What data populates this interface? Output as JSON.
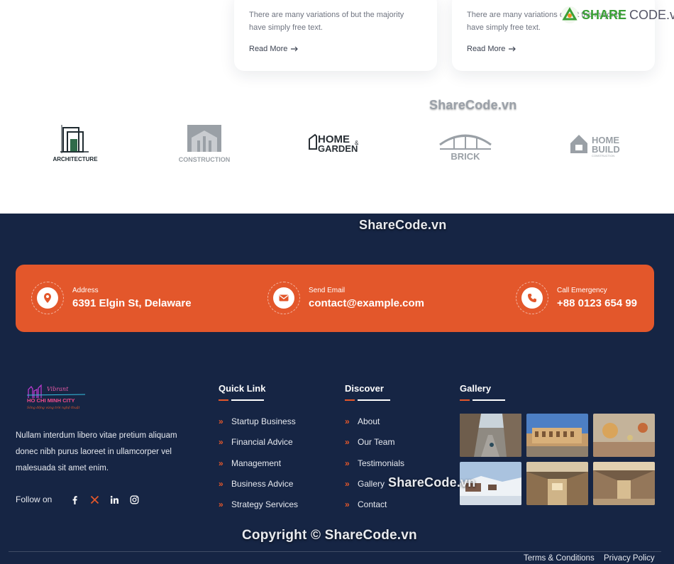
{
  "cards": [
    {
      "text": "There are many variations of but the majority have simply free text.",
      "link": "Read More"
    },
    {
      "text": "There are many variations of but the majority have simply free text.",
      "link": "Read More"
    }
  ],
  "partner_logos": [
    {
      "name": "ARCHITECTURE",
      "icon": "architecture-logo"
    },
    {
      "name": "CONSTRUCTION",
      "icon": "construction-logo"
    },
    {
      "name": "HOME & GARDEN",
      "line1": "HOME",
      "amp": "&",
      "line2": "GARDEN",
      "icon": "home-garden-logo"
    },
    {
      "name": "BRICK",
      "icon": "brick-logo"
    },
    {
      "name": "HOME BUILD",
      "line1": "HOME",
      "line2": "BUILD",
      "sub": "CONSTRUCTION",
      "icon": "home-build-logo"
    }
  ],
  "watermarks": {
    "w1": "ShareCode.vn",
    "w2": "ShareCode.vn",
    "w3": "ShareCode.vn",
    "copyright": "Copyright © ShareCode.vn",
    "corner_brand_a": "SHARE",
    "corner_brand_b": "CODE.vn"
  },
  "contact": [
    {
      "label": "Address",
      "value": "6391 Elgin St, Delaware",
      "icon": "location-pin-icon"
    },
    {
      "label": "Send Email",
      "value": "contact@example.com",
      "icon": "envelope-icon"
    },
    {
      "label": "Call Emergency",
      "value": "+88 0123 654 99",
      "icon": "phone-icon"
    }
  ],
  "brand": {
    "script": "Vibrant",
    "city": "HO CHI MINH CITY",
    "tagline": "Sông động vùng trời nghệ thuật"
  },
  "about": {
    "text": "Nullam interdum libero vitae pretium aliquam donec nibh purus laoreet in ullamcorper vel malesuada sit amet enim.",
    "follow_label": "Follow on",
    "social": [
      "facebook-icon",
      "x-icon",
      "linkedin-icon",
      "instagram-icon"
    ]
  },
  "quick_link": {
    "title": "Quick Link",
    "items": [
      "Startup Business",
      "Financial Advice",
      "Management",
      "Business Advice",
      "Strategy Services"
    ]
  },
  "discover": {
    "title": "Discover",
    "items": [
      "About",
      "Our Team",
      "Testimonials",
      "Gallery",
      "Contact"
    ]
  },
  "gallery": {
    "title": "Gallery",
    "photos": [
      "street-photo",
      "colosseum-photo",
      "balloons-photo",
      "snow-hill-photo",
      "mall-hall-photo",
      "mall-corridor-photo"
    ]
  },
  "legal": {
    "terms": "Terms & Conditions",
    "privacy": "Privacy Policy"
  },
  "colors": {
    "accent": "#e3572b",
    "footer_bg": "#162544"
  }
}
